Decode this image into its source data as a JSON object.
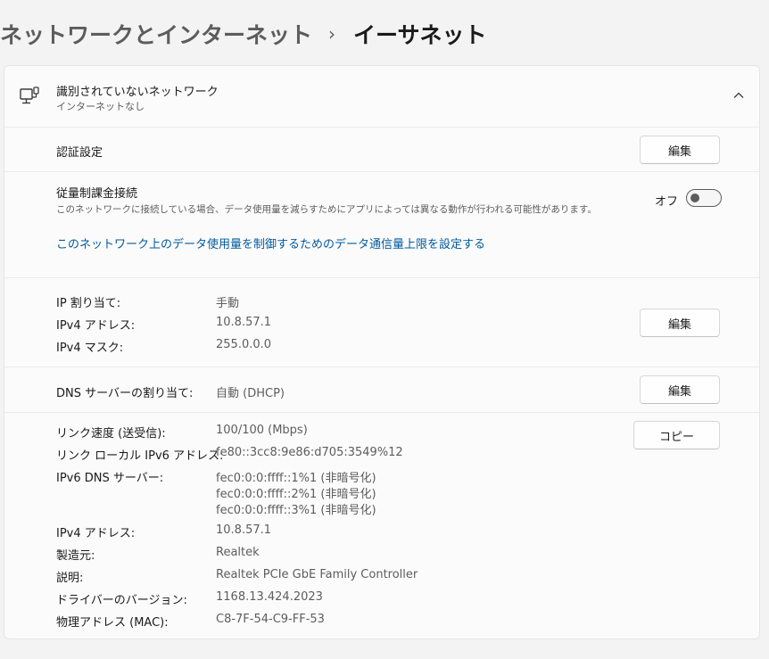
{
  "breadcrumb": {
    "parent": "ネットワークとインターネット",
    "separator": "›",
    "current": "イーサネット"
  },
  "network": {
    "icon": "network-computer-icon",
    "title": "識別されていないネットワーク",
    "subtitle": "インターネットなし",
    "expand_icon": "chevron-up-icon"
  },
  "auth": {
    "label": "認証設定",
    "edit_label": "編集"
  },
  "metered": {
    "label": "従量制課金接続",
    "description": "このネットワークに接続している場合、データ使用量を減らすためにアプリによっては異なる動作が行われる可能性があります。",
    "toggle_state": "オフ",
    "toggle_on": false,
    "link": "このネットワーク上のデータ使用量を制御するためのデータ通信量上限を設定する"
  },
  "ip": {
    "rows": [
      {
        "label": "IP 割り当て:",
        "value": "手動"
      },
      {
        "label": "IPv4 アドレス:",
        "value": "10.8.57.1"
      },
      {
        "label": "IPv4 マスク:",
        "value": "255.0.0.0"
      }
    ],
    "edit_label": "編集"
  },
  "dns": {
    "label": "DNS サーバーの割り当て:",
    "value": "自動 (DHCP)",
    "edit_label": "編集"
  },
  "props": {
    "copy_label": "コピー",
    "link_speed": {
      "label": "リンク速度 (送受信):",
      "value": "100/100 (Mbps)"
    },
    "ipv6_local": {
      "label": "リンク ローカル IPv6 アドレス:",
      "value": "fe80::3cc8:9e86:d705:3549%12"
    },
    "ipv6_dns": {
      "label": "IPv6 DNS サーバー:",
      "values": [
        "fec0:0:0:ffff::1%1 (非暗号化)",
        "fec0:0:0:ffff::2%1 (非暗号化)",
        "fec0:0:0:ffff::3%1 (非暗号化)"
      ]
    },
    "ipv4": {
      "label": "IPv4 アドレス:",
      "value": "10.8.57.1"
    },
    "manufacturer": {
      "label": "製造元:",
      "value": "Realtek"
    },
    "description": {
      "label": "説明:",
      "value": "Realtek PCIe GbE Family Controller"
    },
    "driver": {
      "label": "ドライバーのバージョン:",
      "value": "1168.13.424.2023"
    },
    "mac": {
      "label": "物理アドレス (MAC):",
      "value": "C8-7F-54-C9-FF-53"
    }
  },
  "colors": {
    "link": "#005a9e",
    "background": "#f3f3f3",
    "card": "#fbfbfb"
  }
}
